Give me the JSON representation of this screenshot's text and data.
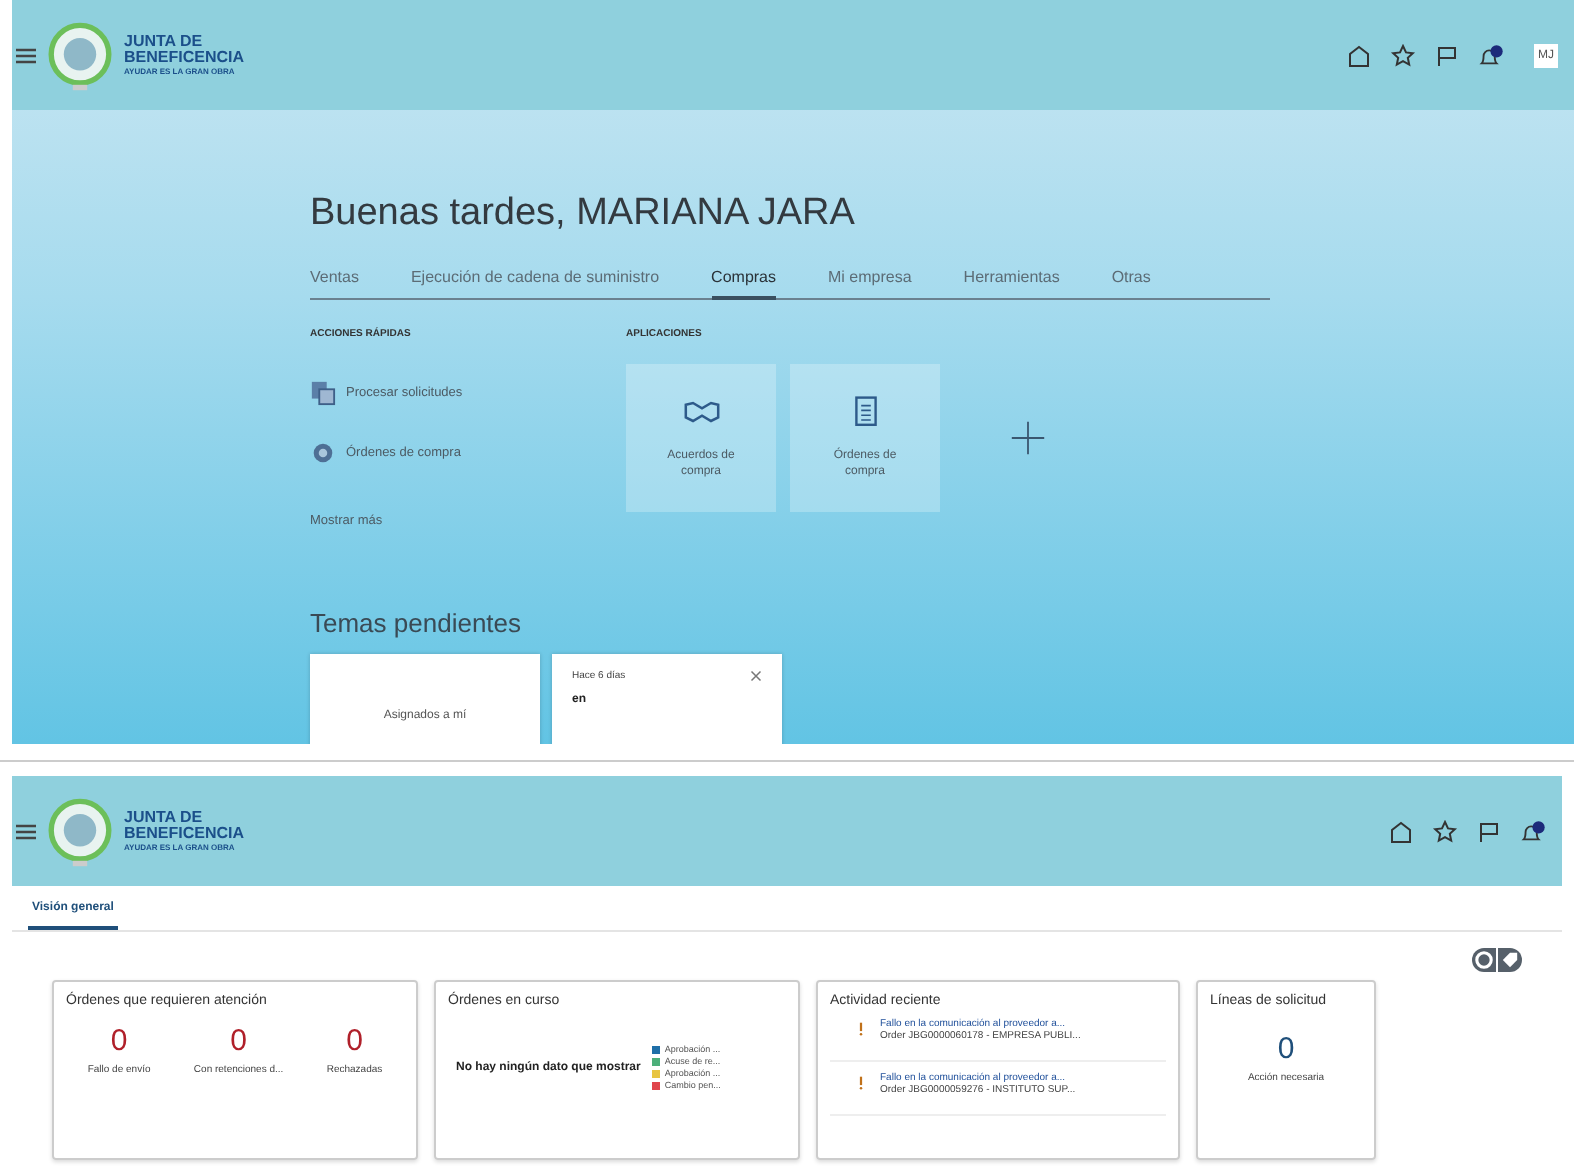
{
  "top_screen": {
    "header": {
      "brand_name": [
        "JUNTA DE",
        "BENEFICENCIA"
      ],
      "brand_tagline": "AYUDAR ES LA GRAN OBRA",
      "avatar": "MJ"
    },
    "greeting": "Buenas tardes, MARIANA JARA",
    "tabs": [
      {
        "label": "Ventas",
        "selected": false
      },
      {
        "label": "Ejecución de cadena de suministro",
        "selected": false
      },
      {
        "label": "Compras",
        "selected": true
      },
      {
        "label": "Mi empresa",
        "selected": false
      },
      {
        "label": "Herramientas",
        "selected": false
      },
      {
        "label": "Otras",
        "selected": false
      }
    ],
    "quick_actions": {
      "title": "ACCIONES RÁPIDAS",
      "items": [
        {
          "label": "Procesar solicitudes",
          "kind": "requests"
        },
        {
          "label": "Órdenes de compra",
          "kind": "orders"
        }
      ],
      "more": "Mostrar más"
    },
    "applications": {
      "title": "APLICACIONES",
      "items": [
        {
          "label": "Acuerdos de compra",
          "kind": "agreement"
        },
        {
          "label": "Órdenes de compra",
          "kind": "document"
        }
      ]
    },
    "pending": {
      "title": "Temas pendientes",
      "cards": [
        {
          "label": "Asignados a mí"
        },
        {
          "time": "Hace 6 días",
          "label": "en"
        }
      ]
    }
  },
  "bottom_screen": {
    "header": {
      "brand_name": [
        "JUNTA DE",
        "BENEFICENCIA"
      ],
      "brand_tagline": "AYUDAR ES LA GRAN OBRA"
    },
    "tabs": [
      {
        "label": "Visión general",
        "selected": true
      }
    ],
    "cards": [
      {
        "kind": "metrics",
        "title": "Órdenes que requieren atención",
        "metrics": [
          {
            "value": "0",
            "label": "Fallo de envío"
          },
          {
            "value": "0",
            "label": "Con retenciones d..."
          },
          {
            "value": "0",
            "label": "Rechazadas"
          }
        ]
      },
      {
        "kind": "chart",
        "title": "Órdenes en curso",
        "empty_message": "No hay ningún dato que mostrar",
        "legend": [
          {
            "label": "Aprobación ...",
            "color": "#1f6fa8"
          },
          {
            "label": "Acuse de re...",
            "color": "#4caf7a"
          },
          {
            "label": "Aprobación ...",
            "color": "#e8c542"
          },
          {
            "label": "Cambio pen...",
            "color": "#e0454b"
          }
        ]
      },
      {
        "kind": "activity",
        "title": "Actividad reciente",
        "items": [
          {
            "title": "Fallo en la comunicación al proveedor a...",
            "detail": "Order JBG0000060178 - EMPRESA PUBLI..."
          },
          {
            "title": "Fallo en la comunicación al proveedor a...",
            "detail": "Order JBG0000059276 - INSTITUTO SUP..."
          }
        ]
      },
      {
        "kind": "count",
        "title": "Líneas de solicitud",
        "value": "0",
        "label": "Acción necesaria"
      }
    ]
  }
}
